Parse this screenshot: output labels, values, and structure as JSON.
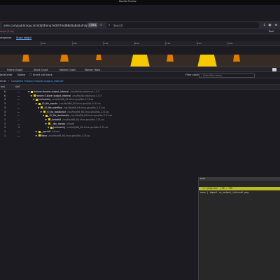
{
  "window": {
    "title": "Mozilla Firefox"
  },
  "urlbar": {
    "url": "ome.com/public/xjuc3cmtdjf4mnp7e0th7md68d4u8a4ufnhjhdsqkm",
    "zoom": "135%",
    "search_placeholder": "Search",
    "search_icon": "search-icon"
  },
  "profiler": {
    "range_label": "ange (3.4s)",
    "help_label": "Prof"
  },
  "track_tabs": [
    "ategories",
    "Stack height"
  ],
  "ruler_ticks": [
    "0.5s",
    "1.0s",
    "1.5s",
    "2.0s",
    "2.5s",
    "3.0s",
    "3.5s"
  ],
  "activity": {
    "colors": {
      "yellow": "#f5c800",
      "orange": "#e07b00",
      "brown": "#6b4e2a"
    },
    "series_note": ""
  },
  "panel_tabs": [
    "Flame Graph",
    "Stack Chart",
    "Marker Chart",
    "Marker Table"
  ],
  "toolbar": {
    "invert_label": "Invert call stack",
    "native_label": "Native",
    "js_label": "JavaScript",
    "filter_label": "Filter stacks:",
    "filter_placeholder": "Enter filter terms"
  },
  "breadcrumb": {
    "first": "ernel",
    "second": "Complete 'rtmore::rtmore::output_internal'"
  },
  "calltree_headers": {
    "running": "ms)",
    "self": "Self"
  },
  "calltree": [
    {
      "running": "6",
      "self": "—",
      "indent": 0,
      "fn": "rtmore::rtmore::output_internal",
      "lib": "/usr/lib/libcudalov.so.1.0.3",
      "selected": false
    },
    {
      "running": "6",
      "self": "—",
      "indent": 1,
      "fn": "rtmore::Cstore::output_internal",
      "lib": "/usr/lib/libcudalov.so.1.0.3",
      "selected": false
    },
    {
      "running": "4",
      "self": "—",
      "indent": 2,
      "fn": "[unknown]",
      "lib": "/usr/lib/x86_64-linux-gnu/libc-2.31.so",
      "selected": false
    },
    {
      "running": "3",
      "self": "—",
      "indent": 3,
      "fn": "_IO_file_xsputn",
      "lib": "/usr/lib/x86_64-linux-gnu/libc-2.31.so",
      "selected": false
    },
    {
      "running": "3",
      "self": "—",
      "indent": 4,
      "fn": "_IO_file_overflow",
      "lib": "/usr/lib/x86_64-linux-gnu/libc-2.31.so",
      "selected": false
    },
    {
      "running": "3",
      "self": "—",
      "indent": 5,
      "fn": "_IO_do_doallocbuf",
      "lib": "/usr/lib/x86_64-linux-gnu/libc-2.31.so",
      "selected": false
    },
    {
      "running": "3",
      "self": "—",
      "indent": 6,
      "fn": "_IO_file_doallocate",
      "lib": "/usr/lib/x86_64-linux-gnu/libc-2.31.so",
      "selected": false
    },
    {
      "running": "1",
      "self": "—",
      "indent": 7,
      "fn": "_fxstat64",
      "lib": "/usr/lib/x86_64-linux-gnu/libc-2.31.so",
      "selected": false
    },
    {
      "running": "1",
      "self": "—",
      "indent": 7,
      "fn": "__libc_malloc",
      "lib": "inlined",
      "selected": false
    },
    {
      "running": "1",
      "self": "1",
      "indent": 8,
      "fn": "[unknown]",
      "lib": "/usr/lib/x86_64-linux-gnu/libc-2.31.so",
      "selected": false
    },
    {
      "running": "1",
      "self": "—",
      "indent": 3,
      "fn": "__sprintf",
      "lib": "inlined",
      "selected": false
    },
    {
      "running": "1",
      "self": "—",
      "indent": 3,
      "fn": "fileno",
      "lib": "/usr/lib/x86_64-linux-gnu/libc-2.31.so",
      "selected": false
    }
  ],
  "terminal": {
    "title": "bash",
    "status": " ~/rr/8ybyfun  [98 → ?98 -  ",
    "command": "uwuu | import vy_output_internal.png"
  }
}
